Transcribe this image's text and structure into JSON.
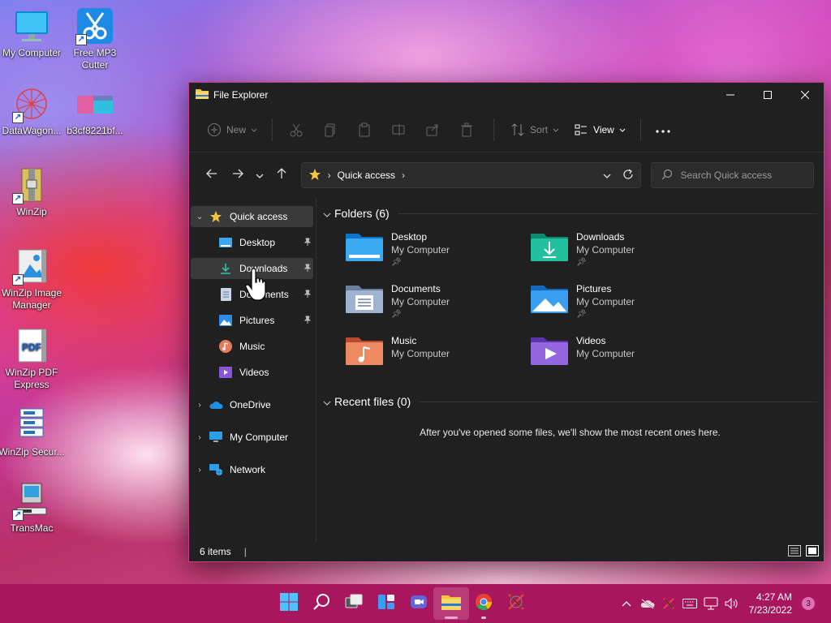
{
  "desktop": {
    "icons": [
      {
        "label": "My Computer",
        "icon": "monitor-icon"
      },
      {
        "label": "Free MP3 Cutter",
        "icon": "scissors-icon"
      },
      {
        "label": "DataWagon...",
        "icon": "network-sphere-icon"
      },
      {
        "label": "b3cf8221bf...",
        "icon": "image-thumbnail-icon"
      },
      {
        "label": "WinZip",
        "icon": "winzip-icon"
      },
      {
        "label": "WinZip Image Manager",
        "icon": "winzip-image-icon"
      },
      {
        "label": "WinZip PDF Express",
        "icon": "pdf-icon"
      },
      {
        "label": "WinZip Secur...",
        "icon": "winzip-secure-icon"
      },
      {
        "label": "TransMac",
        "icon": "transmac-icon"
      }
    ]
  },
  "window": {
    "title": "File Explorer",
    "toolbar": {
      "new_label": "New",
      "sort_label": "Sort",
      "view_label": "View"
    },
    "address": {
      "location": "Quick access"
    },
    "search": {
      "placeholder": "Search Quick access"
    },
    "nav": {
      "quick_access": "Quick access",
      "pinned": [
        {
          "label": "Desktop",
          "icon": "desktop-folder-icon"
        },
        {
          "label": "Downloads",
          "icon": "download-icon"
        },
        {
          "label": "Documents",
          "icon": "documents-icon"
        },
        {
          "label": "Pictures",
          "icon": "pictures-icon"
        }
      ],
      "unpinned": [
        {
          "label": "Music",
          "icon": "music-icon"
        },
        {
          "label": "Videos",
          "icon": "videos-icon"
        }
      ],
      "onedrive": "OneDrive",
      "my_computer": "My Computer",
      "network": "Network"
    },
    "main": {
      "folders_heading": "Folders (6)",
      "folders": [
        {
          "name": "Desktop",
          "location": "My Computer",
          "pinned": true,
          "color": "#1e9be8"
        },
        {
          "name": "Downloads",
          "location": "My Computer",
          "pinned": true,
          "color": "#1eb59a"
        },
        {
          "name": "Documents",
          "location": "My Computer",
          "pinned": true,
          "color": "#8c9fbf"
        },
        {
          "name": "Pictures",
          "location": "My Computer",
          "pinned": true,
          "color": "#2a8ee8"
        },
        {
          "name": "Music",
          "location": "My Computer",
          "pinned": false,
          "color": "#e86f4a"
        },
        {
          "name": "Videos",
          "location": "My Computer",
          "pinned": false,
          "color": "#8a55d8"
        }
      ],
      "recent_heading": "Recent files (0)",
      "recent_message": "After you've opened some files, we'll show the most recent ones here."
    },
    "status": {
      "item_count": "6 items"
    }
  },
  "taskbar": {
    "apps": [
      "start-icon",
      "search-icon",
      "task-view-icon",
      "widgets-icon",
      "chat-icon",
      "file-explorer-icon",
      "chrome-icon",
      "xcode-tool-icon"
    ],
    "clock_time": "4:27 AM",
    "clock_date": "7/23/2022",
    "notification_count": "3"
  },
  "colors": {
    "accent": "#c1418c",
    "taskbar": "#a8165e",
    "window_bg": "#202020"
  }
}
